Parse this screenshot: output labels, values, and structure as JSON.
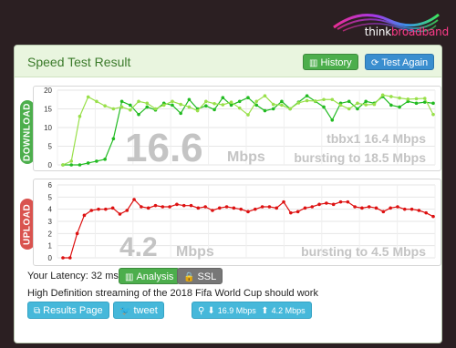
{
  "brand": {
    "think": "think",
    "broadband": "broadband"
  },
  "header": {
    "title": "Speed Test Result",
    "history_label": "History",
    "test_again_label": "Test Again"
  },
  "download": {
    "label": "DOWNLOAD",
    "big_value": "16.6",
    "unit": "Mbps",
    "tbbx_text": "tbbx1 16.4 Mbps",
    "bursting_text": "bursting to 18.5 Mbps",
    "y_ticks": [
      "20",
      "15",
      "10",
      "5",
      "0"
    ],
    "color": "#22bb22",
    "color2": "#99e04a"
  },
  "upload": {
    "label": "UPLOAD",
    "big_value": "4.2",
    "unit": "Mbps",
    "bursting_text": "bursting to 4.5 Mbps",
    "y_ticks": [
      "6",
      "5",
      "4",
      "3",
      "2",
      "1",
      "0"
    ],
    "color": "#dd1111"
  },
  "chart_data": [
    {
      "type": "line",
      "title": "DOWNLOAD",
      "ylim": [
        0,
        20
      ],
      "series": [
        {
          "values": [
            0,
            0,
            0,
            0.5,
            1,
            1.5,
            7,
            17,
            16,
            13.5,
            15.5,
            14.7,
            16.5,
            16,
            13.8,
            17.5,
            15,
            15.8,
            14.8,
            18,
            16,
            17,
            18,
            16,
            14.5,
            15,
            17,
            15,
            16.8,
            18.5,
            17,
            15.5,
            12,
            16.5,
            17,
            15,
            17,
            16.5,
            18.3,
            16,
            15.5,
            17,
            16.5,
            16.8,
            16.5
          ]
        },
        {
          "values": [
            0,
            1,
            13,
            18.2,
            17,
            15.8,
            15,
            15.5,
            14.7,
            17,
            16.5,
            15,
            16,
            17,
            16.2,
            15.5,
            14.5,
            17,
            16.4,
            16.1,
            16.8,
            15.2,
            13.4,
            17,
            18.5,
            16.2,
            16,
            15,
            16.6,
            17.2,
            17.1,
            17.5,
            17.5,
            16,
            15,
            16.5,
            16.1,
            16.2,
            18.7,
            18.3,
            17.9,
            17.6,
            17.7,
            17.8,
            13.5
          ]
        }
      ]
    },
    {
      "type": "line",
      "title": "UPLOAD",
      "ylim": [
        0,
        6
      ],
      "series": [
        {
          "values": [
            0,
            0,
            2,
            3.5,
            3.9,
            4,
            4,
            4.1,
            3.6,
            3.9,
            4.8,
            4.2,
            4.1,
            4.3,
            4.2,
            4.2,
            4.4,
            4.3,
            4.3,
            4.1,
            4.2,
            3.9,
            4.1,
            4.2,
            4.1,
            4,
            3.8,
            4,
            4.2,
            4.2,
            4.1,
            4.6,
            3.7,
            3.8,
            4.1,
            4.2,
            4.4,
            4.5,
            4.4,
            4.6,
            4.6,
            4.2,
            4.1,
            4.2,
            4.1,
            3.8,
            4.1,
            4.2,
            4,
            4,
            3.9,
            3.7,
            3.4
          ]
        }
      ]
    }
  ],
  "latency": {
    "label": "Your Latency: 32 ms",
    "analysis_label": "Analysis",
    "ssl_label": "SSL"
  },
  "streaming_text": "High Definition streaming of the 2018 Fifa World Cup should work",
  "actions": {
    "results_label": "Results Page",
    "tweet_label": "tweet",
    "speed_badge_down": "16.9 Mbps",
    "speed_badge_up": "4.2 Mbps"
  }
}
